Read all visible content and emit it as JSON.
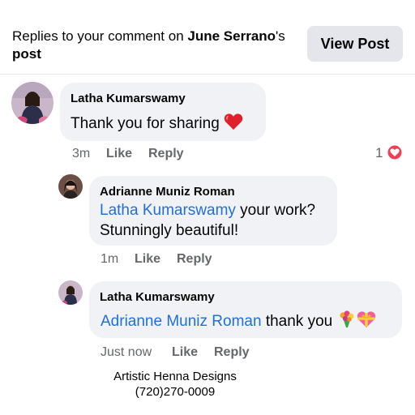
{
  "header": {
    "prefix": "Replies to your comment on ",
    "post_author": "June Serrano",
    "suffix": "'s",
    "post_word": "post",
    "view_post_label": "View Post"
  },
  "comments": [
    {
      "author": "Latha Kumarswamy",
      "text": "Thank you for sharing",
      "emoji": "red-heart",
      "time": "3m",
      "like_label": "Like",
      "reply_label": "Reply",
      "reaction_count": "1",
      "reaction_type": "love"
    },
    {
      "author": "Adrianne Muniz Roman",
      "mention": "Latha Kumarswamy",
      "text_line1": " your work?",
      "text_line2": "Stunningly beautiful!",
      "time": "1m",
      "like_label": "Like",
      "reply_label": "Reply"
    },
    {
      "author": "Latha Kumarswamy",
      "mention": "Adrianne Muniz Roman",
      "text": " thank you",
      "emojis": [
        "bouquet",
        "heart-with-ribbon"
      ],
      "time": "Just now",
      "like_label": "Like",
      "reply_label": "Reply"
    }
  ],
  "watermark": {
    "line1": "Artistic Henna Designs",
    "line2": "(720)270-0009"
  },
  "colors": {
    "mention": "#216fdb",
    "bubble": "#f0f2f5",
    "meta": "#65676b",
    "love": "#f33e58",
    "button": "#e4e6eb"
  }
}
